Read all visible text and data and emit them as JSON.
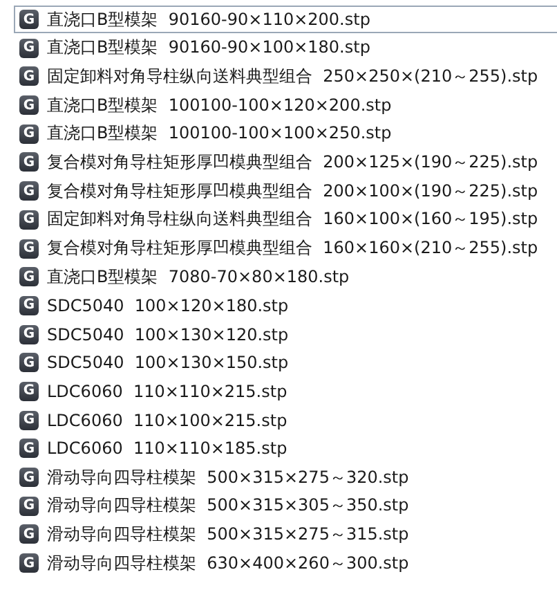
{
  "files": [
    {
      "icon": "G",
      "name": "直浇口B型模架  90160-90×110×200.stp",
      "selected": true
    },
    {
      "icon": "G",
      "name": "直浇口B型模架  90160-90×100×180.stp",
      "selected": false
    },
    {
      "icon": "G",
      "name": "固定卸料对角导柱纵向送料典型组合  250×250×(210～255).stp",
      "selected": false
    },
    {
      "icon": "G",
      "name": "直浇口B型模架  100100-100×120×200.stp",
      "selected": false
    },
    {
      "icon": "G",
      "name": "直浇口B型模架  100100-100×100×250.stp",
      "selected": false
    },
    {
      "icon": "G",
      "name": "复合模对角导柱矩形厚凹模典型组合  200×125×(190～225).stp",
      "selected": false
    },
    {
      "icon": "G",
      "name": "复合模对角导柱矩形厚凹模典型组合  200×100×(190～225).stp",
      "selected": false
    },
    {
      "icon": "G",
      "name": "固定卸料对角导柱纵向送料典型组合  160×100×(160～195).stp",
      "selected": false
    },
    {
      "icon": "G",
      "name": "复合模对角导柱矩形厚凹模典型组合  160×160×(210～255).stp",
      "selected": false
    },
    {
      "icon": "G",
      "name": "直浇口B型模架  7080-70×80×180.stp",
      "selected": false
    },
    {
      "icon": "G",
      "name": "SDC5040  100×120×180.stp",
      "selected": false
    },
    {
      "icon": "G",
      "name": "SDC5040  100×130×120.stp",
      "selected": false
    },
    {
      "icon": "G",
      "name": "SDC5040  100×130×150.stp",
      "selected": false
    },
    {
      "icon": "G",
      "name": "LDC6060  110×110×215.stp",
      "selected": false
    },
    {
      "icon": "G",
      "name": "LDC6060  110×100×215.stp",
      "selected": false
    },
    {
      "icon": "G",
      "name": "LDC6060  110×110×185.stp",
      "selected": false
    },
    {
      "icon": "G",
      "name": "滑动导向四导柱模架  500×315×275～320.stp",
      "selected": false
    },
    {
      "icon": "G",
      "name": "滑动导向四导柱模架  500×315×305～350.stp",
      "selected": false
    },
    {
      "icon": "G",
      "name": "滑动导向四导柱模架  500×315×275～315.stp",
      "selected": false
    },
    {
      "icon": "G",
      "name": "滑动导向四导柱模架  630×400×260～300.stp",
      "selected": false
    }
  ]
}
